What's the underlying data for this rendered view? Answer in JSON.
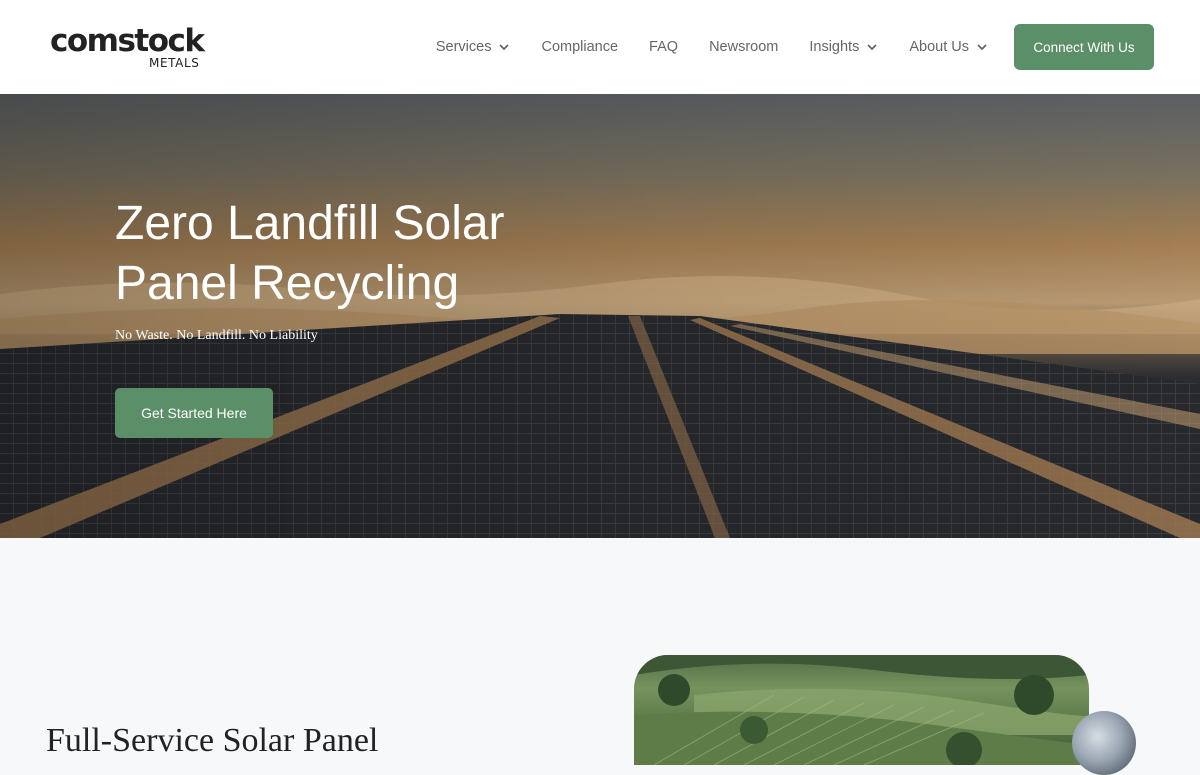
{
  "brand": {
    "name": "comstock",
    "sub": "METALS"
  },
  "nav": {
    "items": [
      {
        "label": "Services",
        "dropdown": true
      },
      {
        "label": "Compliance",
        "dropdown": false
      },
      {
        "label": "FAQ",
        "dropdown": false
      },
      {
        "label": "Newsroom",
        "dropdown": false
      },
      {
        "label": "Insights",
        "dropdown": true
      },
      {
        "label": "About Us",
        "dropdown": true
      }
    ],
    "cta": "Connect With Us"
  },
  "hero": {
    "title": "Zero Landfill Solar Panel Recycling",
    "subtitle": "No Waste. No Landfill. No Liability",
    "button": "Get Started Here"
  },
  "section": {
    "heading": "Full-Service Solar Panel"
  },
  "colors": {
    "accent": "#5b8f68",
    "nav_text": "#666666",
    "header_bg": "#ffffff",
    "page_bg": "#f6f8fa"
  }
}
